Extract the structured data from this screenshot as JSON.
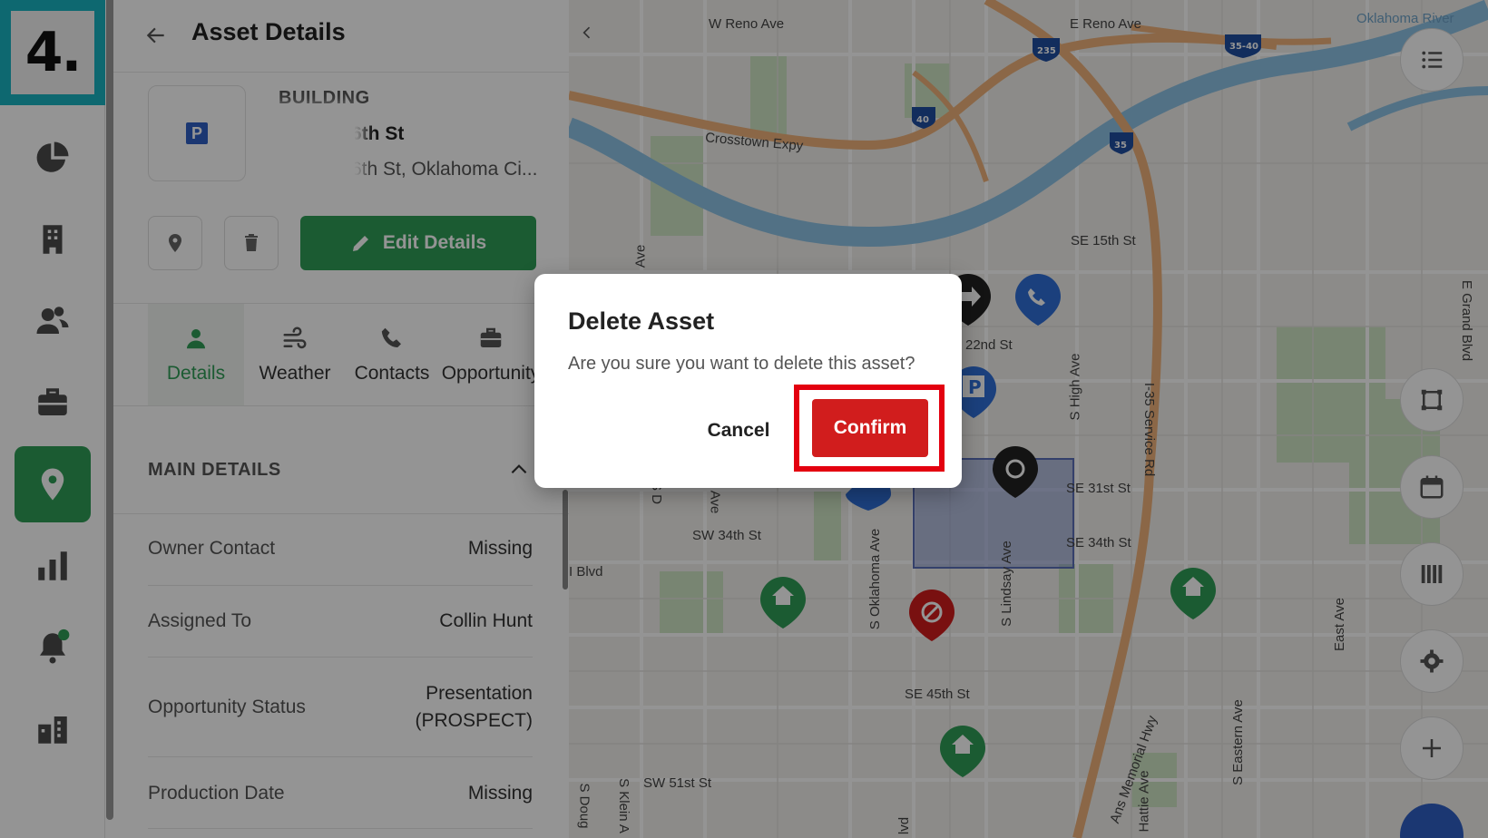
{
  "step_badge": "4.",
  "colors": {
    "brand_green": "#2f9e57",
    "danger_red": "#d11d1d",
    "highlight_red": "#e3000f",
    "badge_teal": "#19b3c2",
    "parking_blue": "#2f5fc4"
  },
  "sidebar": {
    "items": [
      {
        "icon": "pie-chart-icon"
      },
      {
        "icon": "building-icon"
      },
      {
        "icon": "contacts-icon"
      },
      {
        "icon": "briefcase-icon"
      },
      {
        "icon": "map-pin-icon",
        "active": true
      },
      {
        "icon": "bar-chart-icon"
      },
      {
        "icon": "bell-icon"
      },
      {
        "icon": "buildings-icon"
      }
    ]
  },
  "panel": {
    "title": "Asset Details",
    "asset": {
      "type": "BUILDING",
      "name_visible": "6th St",
      "address_visible": "6th St, Oklahoma Ci..."
    },
    "actions": {
      "edit_label": "Edit Details"
    },
    "tabs": [
      {
        "label": "Details",
        "icon": "person-icon",
        "active": true
      },
      {
        "label": "Weather",
        "icon": "wind-icon"
      },
      {
        "label": "Contacts",
        "icon": "phone-icon"
      },
      {
        "label": "Opportunity",
        "icon": "briefcase-icon"
      }
    ],
    "section": {
      "title": "MAIN DETAILS"
    },
    "details": [
      {
        "label": "Owner Contact",
        "value": "Missing"
      },
      {
        "label": "Assigned To",
        "value": "Collin Hunt"
      },
      {
        "label": "Opportunity Status",
        "value": "Presentation\n(PROSPECT)"
      },
      {
        "label": "Production Date",
        "value": "Missing"
      }
    ]
  },
  "map": {
    "streets": [
      "W Reno Ave",
      "E Reno Ave",
      "Oklahoma River",
      "Crosstown Expy",
      "SE 15th St",
      "22nd St",
      "S High Ave",
      "I-35 Service Rd",
      "E Grand Blvd",
      "SE 31st St",
      "SE 34th St",
      "SW 34th St",
      "S Oklahoma Ave",
      "S Lindsay Ave",
      "I Blvd",
      "SE 45th St",
      "SW 51st St",
      "S Klein A",
      "S Doug",
      "Ans Memorial Hwy",
      "Hattie Ave",
      "S Eastern Ave",
      "East Ave",
      "Ave",
      "S D",
      "Ave",
      "lvd"
    ],
    "shields": [
      "235",
      "35-40",
      "40",
      "35"
    ]
  },
  "modal": {
    "title": "Delete Asset",
    "message": "Are you sure you want to delete this asset?",
    "cancel_label": "Cancel",
    "confirm_label": "Confirm"
  }
}
